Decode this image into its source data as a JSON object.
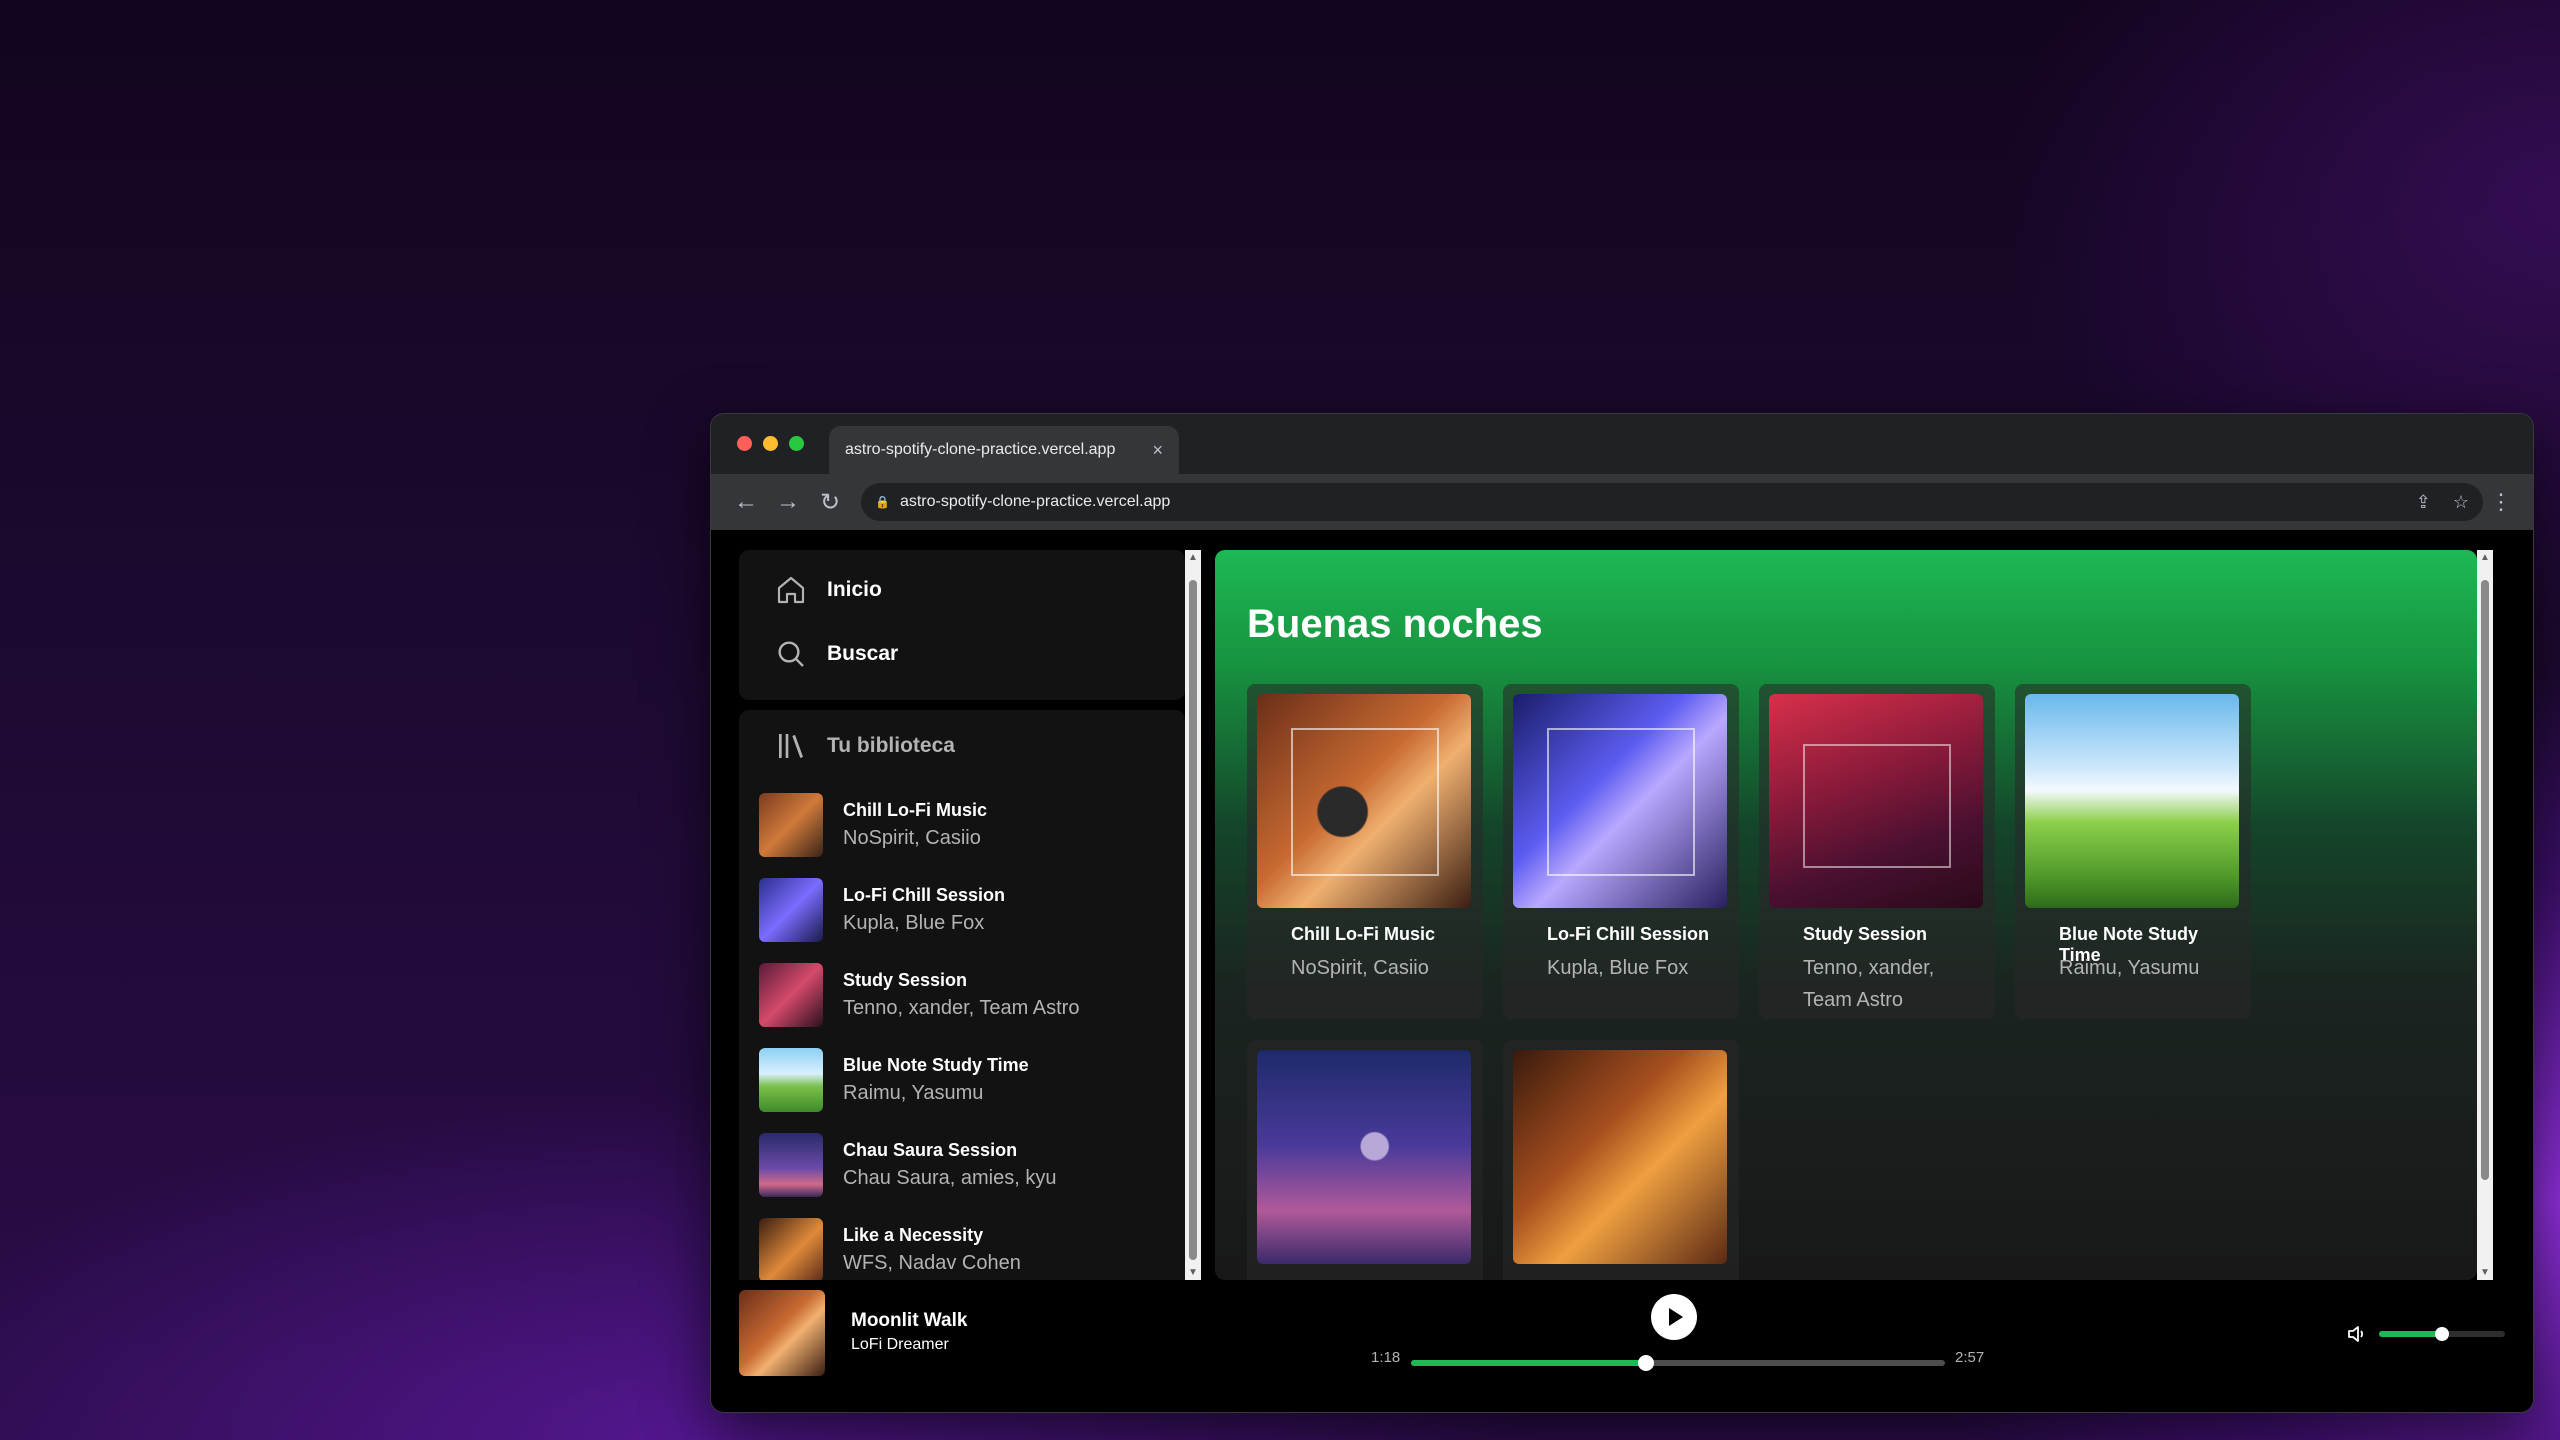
{
  "browser": {
    "tab_title": "astro-spotify-clone-practice.vercel.app",
    "tab_close": "×",
    "url": "astro-spotify-clone-practice.vercel.app"
  },
  "nav": {
    "home": "Inicio",
    "search": "Buscar",
    "library": "Tu biblioteca"
  },
  "library": [
    {
      "title": "Chill Lo-Fi Music",
      "artists": "NoSpirit, Casiio"
    },
    {
      "title": "Lo-Fi Chill Session",
      "artists": "Kupla, Blue Fox"
    },
    {
      "title": "Study Session",
      "artists": "Tenno, xander, Team Astro"
    },
    {
      "title": "Blue Note Study Time",
      "artists": "Raimu, Yasumu"
    },
    {
      "title": "Chau Saura Session",
      "artists": "Chau Saura, amies, kyu"
    },
    {
      "title": "Like a Necessity",
      "artists": "WFS, Nadav Cohen"
    }
  ],
  "main": {
    "greeting": "Buenas noches",
    "cards": [
      {
        "title": "Chill Lo-Fi Music",
        "artists": "NoSpirit, Casiio"
      },
      {
        "title": "Lo-Fi Chill Session",
        "artists": "Kupla, Blue Fox"
      },
      {
        "title": "Study Session",
        "artists": "Tenno, xander, Team Astro"
      },
      {
        "title": "Blue Note Study Time",
        "artists": "Raimu, Yasumu"
      }
    ]
  },
  "player": {
    "track": "Moonlit Walk",
    "artist": "LoFi Dreamer",
    "elapsed": "1:18",
    "duration": "2:57",
    "progress": 0.44,
    "volume": 0.5
  },
  "colors": {
    "accent": "#1db954",
    "background": "#000000",
    "panel": "#121212"
  }
}
